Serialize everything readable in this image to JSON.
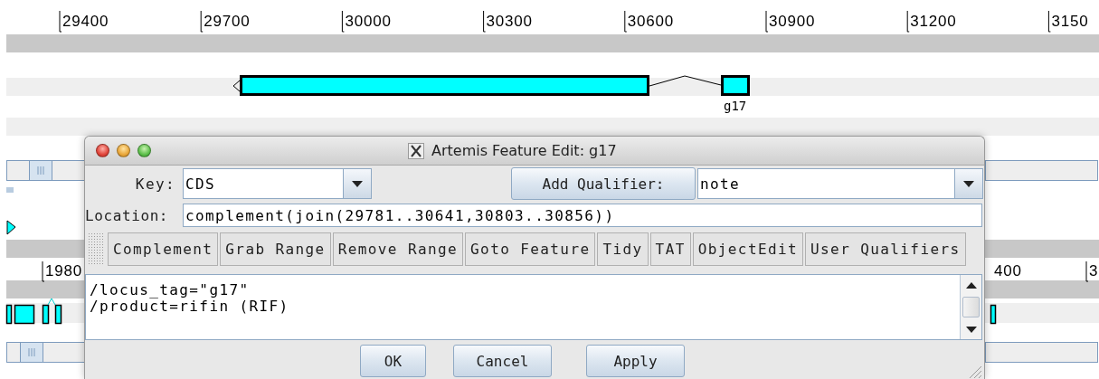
{
  "ruler_top": {
    "ticks": [
      "29400",
      "29700",
      "30000",
      "30300",
      "30600",
      "30900",
      "31200",
      "3150"
    ]
  },
  "feature": {
    "label": "g17"
  },
  "ruler_bottom": {
    "ticks": [
      "1980",
      "400",
      "3"
    ]
  },
  "dialog": {
    "title": "Artemis Feature Edit: g17",
    "key_label": "Key:",
    "key_value": "CDS",
    "add_qualifier_button": "Add Qualifier:",
    "qualifier_value": "note",
    "location_label": "Location:",
    "location_value": "complement(join(29781..30641,30803..30856))",
    "tool_buttons": [
      "Complement",
      "Grab Range",
      "Remove Range",
      "Goto Feature",
      "Tidy",
      "TAT",
      "ObjectEdit",
      "User Qualifiers"
    ],
    "qualifiers_text": [
      "/locus_tag=\"g17\"",
      "/product=rifin (RIF)"
    ],
    "buttons": [
      "OK",
      "Cancel",
      "Apply"
    ]
  }
}
